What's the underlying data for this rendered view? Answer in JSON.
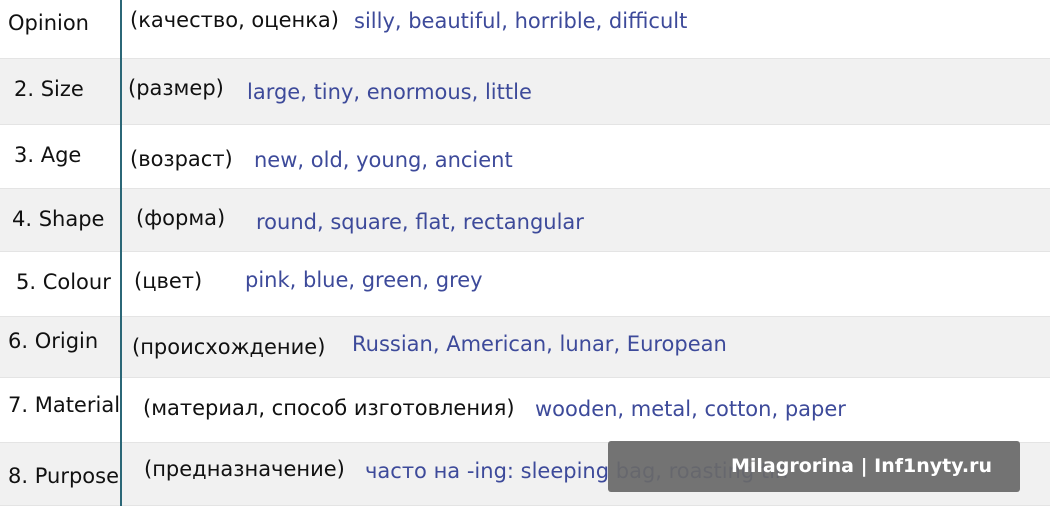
{
  "rows": [
    {
      "label": "Opinion",
      "ru": "(качество, оценка)",
      "examples": "silly, beautiful, horrible, difficult"
    },
    {
      "label": "2. Size",
      "ru": "(размер)",
      "examples": "large, tiny, enormous, little"
    },
    {
      "label": "3. Age",
      "ru": "(возраст)",
      "examples": "new, old, young, ancient"
    },
    {
      "label": "4. Shape",
      "ru": "(форма)",
      "examples": "round, square, flat, rectangular"
    },
    {
      "label": "5. Colour",
      "ru": "(цвет)",
      "examples": "pink, blue, green, grey"
    },
    {
      "label": "6. Origin",
      "ru": "(происхождение)",
      "examples": "Russian, American, lunar, European"
    },
    {
      "label": "7. Material",
      "ru": "(материал, способ изготовления)",
      "examples": "wooden, metal, cotton, paper"
    },
    {
      "label": "8. Purpose",
      "ru": "(предназначение)",
      "examples": "часто на -ing: sleeping bag, roasting tin"
    }
  ],
  "watermark": "Milagrorina | Inf1nyty.ru"
}
